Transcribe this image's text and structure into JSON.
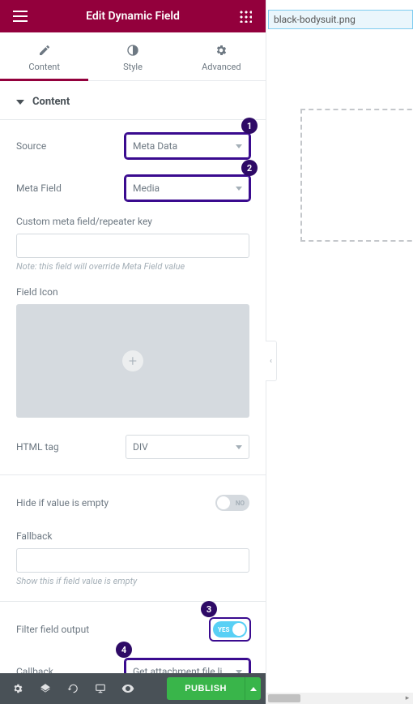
{
  "header": {
    "title": "Edit Dynamic Field"
  },
  "tabs": {
    "content": "Content",
    "style": "Style",
    "advanced": "Advanced"
  },
  "section": {
    "title": "Content"
  },
  "fields": {
    "source": {
      "label": "Source",
      "value": "Meta Data"
    },
    "meta_field": {
      "label": "Meta Field",
      "value": "Media"
    },
    "custom_key": {
      "label": "Custom meta field/repeater key",
      "note": "Note: this field will override Meta Field value"
    },
    "field_icon": {
      "label": "Field Icon"
    },
    "html_tag": {
      "label": "HTML tag",
      "value": "DIV"
    },
    "hide_empty": {
      "label": "Hide if value is empty",
      "state": "NO"
    },
    "fallback": {
      "label": "Fallback",
      "note": "Show this if field value is empty"
    },
    "filter_output": {
      "label": "Filter field output",
      "state": "YES"
    },
    "callback": {
      "label": "Callback",
      "value": "Get attachment file link"
    }
  },
  "badges": {
    "b1": "1",
    "b2": "2",
    "b3": "3",
    "b4": "4"
  },
  "footer": {
    "publish": "PUBLISH"
  },
  "preview": {
    "filename": "black-bodysuit.png"
  }
}
